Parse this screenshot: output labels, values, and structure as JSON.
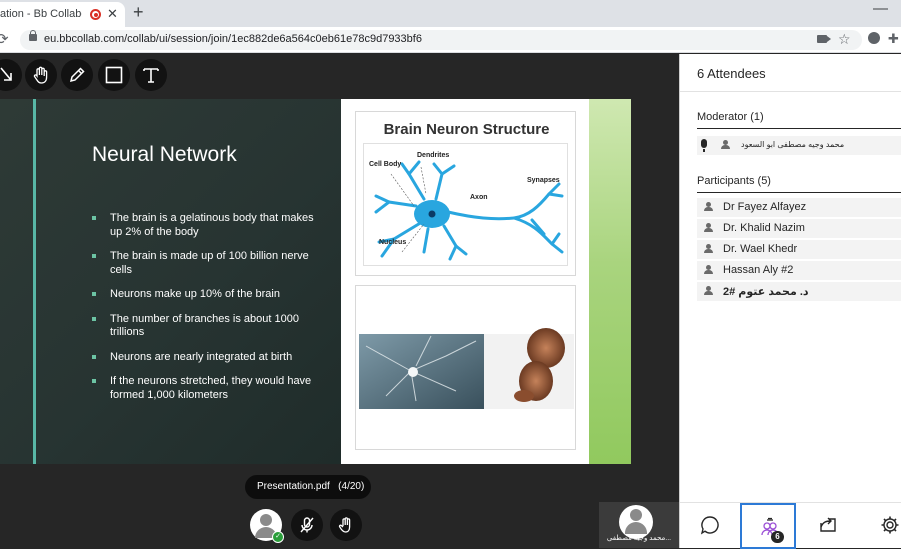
{
  "browser": {
    "tab_title": "ation - Bb Collaborat",
    "tab_close": "✕",
    "new_tab": "+",
    "minimize": "—",
    "url": "eu.bbcollab.com/collab/ui/session/join/1ec882de6a564c0eb61e78c9d7933bf6"
  },
  "stage": {
    "tools": [
      "select-icon",
      "hand-icon",
      "pencil-icon",
      "square-icon",
      "text-icon"
    ],
    "slide": {
      "title": "Neural Network",
      "bullets": [
        "The brain is a gelatinous body that makes up 2% of the body",
        "The brain is made up of 100 billion nerve cells",
        "Neurons make up 10% of the brain",
        "The number of branches is about 1000 trillions",
        "Neurons are nearly integrated at birth",
        "If the neurons stretched, they would have formed 1,000 kilometers"
      ],
      "diagram_title": "Brain Neuron Structure",
      "diagram_labels": {
        "cell_body": "Cell Body",
        "dendrites": "Dendrites",
        "synapses": "Synapses",
        "axon": "Axon",
        "nucleus": "Nucleus"
      }
    },
    "presentation_file": "Presentation.pdf",
    "presentation_page": "(4/20)",
    "self_name": "محمد وجيه مصطفى..."
  },
  "panel": {
    "title": "6 Attendees",
    "moderator_head": "Moderator (1)",
    "moderator": "محمد وجيه مصطفى ابو السعود",
    "participants_head": "Participants (5)",
    "participants": [
      "Dr Fayez Alfayez",
      "Dr. Khalid Nazim",
      "Dr. Wael Khedr",
      "Hassan Aly #2",
      "د. محمد عتوم #2"
    ],
    "attendee_badge": "6"
  },
  "colors": {
    "accent": "#2d7ad6",
    "record": "#d93025",
    "stage_bg": "#262626",
    "neuron_blue": "#29a6df",
    "slide_stripe": "#58b7a6"
  }
}
